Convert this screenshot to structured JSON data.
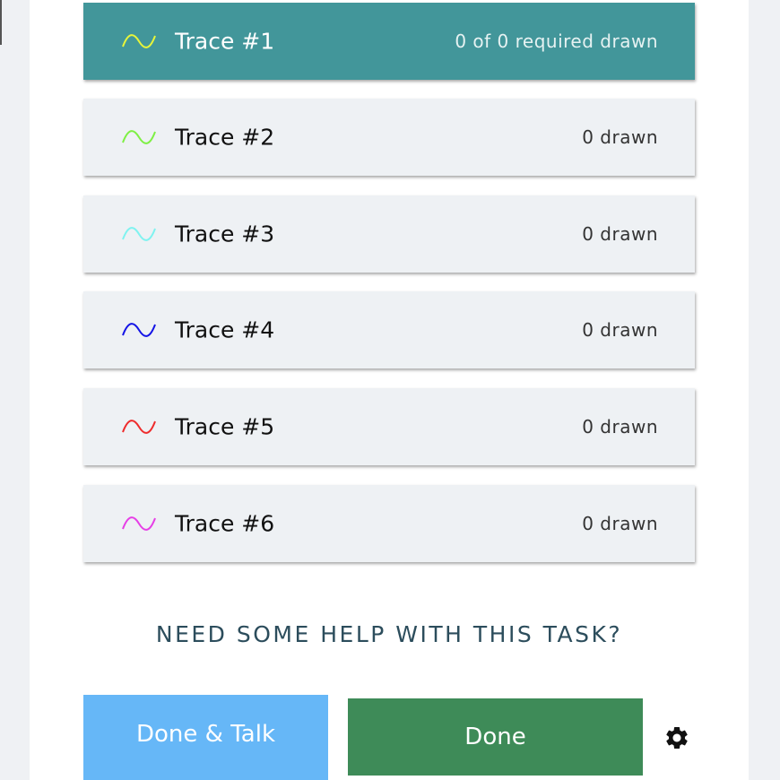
{
  "traces": [
    {
      "label": "Trace #1",
      "count": "0 of 0 required drawn",
      "color": "#e7f53a",
      "active": true
    },
    {
      "label": "Trace #2",
      "count": "0 drawn",
      "color": "#7ef044",
      "active": false
    },
    {
      "label": "Trace #3",
      "count": "0 drawn",
      "color": "#7ff3f0",
      "active": false
    },
    {
      "label": "Trace #4",
      "count": "0 drawn",
      "color": "#1414e6",
      "active": false
    },
    {
      "label": "Trace #5",
      "count": "0 drawn",
      "color": "#ee2c2c",
      "active": false
    },
    {
      "label": "Trace #6",
      "count": "0 drawn",
      "color": "#e63fe6",
      "active": false
    }
  ],
  "help": {
    "label": "NEED SOME HELP WITH THIS TASK?"
  },
  "actions": {
    "done_talk_label": "Done & Talk",
    "done_label": "Done"
  },
  "icons": {
    "wave": "sine-wave-icon",
    "settings": "gear-icon"
  },
  "colors": {
    "active_bg": "#42969a",
    "done_talk_bg": "#66b7f7",
    "done_bg": "#3e8b58",
    "help_text": "#2c4d5c"
  }
}
